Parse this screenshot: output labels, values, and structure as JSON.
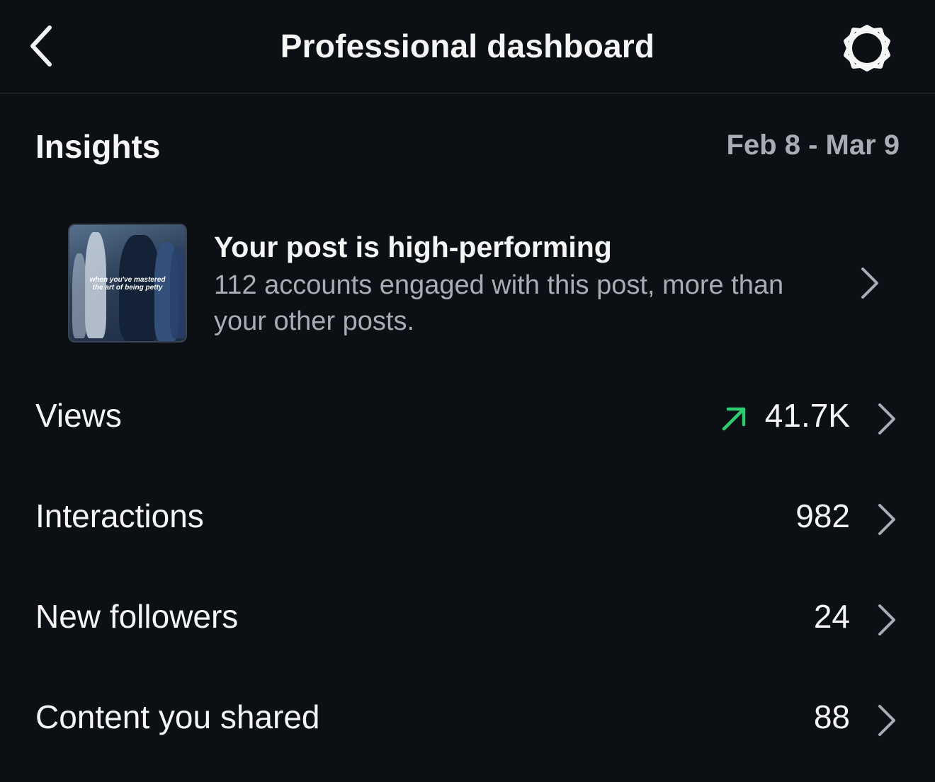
{
  "header": {
    "title": "Professional dashboard",
    "back_icon": "chevron-left-icon",
    "settings_icon": "gear-icon"
  },
  "insights": {
    "title": "Insights",
    "date_range": "Feb 8 - Mar 9"
  },
  "highlight": {
    "thumbnail_caption_line1": "when you've mastered",
    "thumbnail_caption_line2": "the art of being petty",
    "title": "Your post is high-performing",
    "body": "112 accounts engaged with this post, more than your other posts."
  },
  "metrics": [
    {
      "label": "Views",
      "value": "41.7K",
      "trend": "up",
      "trend_color": "#2ecc71"
    },
    {
      "label": "Interactions",
      "value": "982"
    },
    {
      "label": "New followers",
      "value": "24"
    },
    {
      "label": "Content you shared",
      "value": "88"
    }
  ],
  "colors": {
    "background": "#0c1014",
    "primary_text": "#f5f5f5",
    "secondary_text": "#a8adb3",
    "trend_up": "#2ecc71"
  }
}
